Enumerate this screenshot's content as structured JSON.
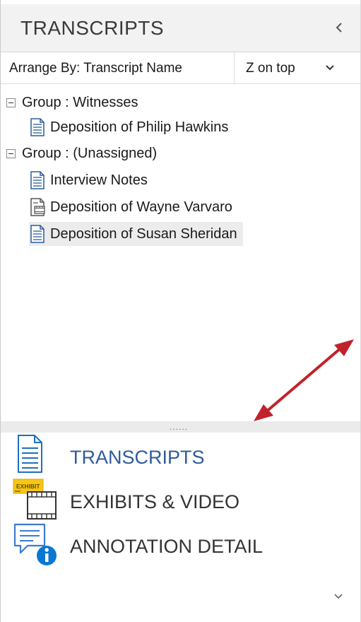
{
  "panel": {
    "title": "TRANSCRIPTS"
  },
  "arrange": {
    "label": "Arrange By: Transcript Name",
    "order_selected": "Z on top"
  },
  "tree": {
    "groups": [
      {
        "label": "Group : Witnesses",
        "items": [
          {
            "label": "Deposition of Philip Hawkins",
            "icon": "document-icon"
          }
        ]
      },
      {
        "label": "Group : (Unassigned)",
        "items": [
          {
            "label": "Interview Notes",
            "icon": "document-icon"
          },
          {
            "label": "Deposition of Wayne Varvaro",
            "icon": "video-document-icon"
          },
          {
            "label": "Deposition of Susan Sheridan",
            "icon": "document-icon",
            "selected": true
          }
        ]
      }
    ]
  },
  "splitter": {
    "grip": "......"
  },
  "nav": {
    "transcripts": "TRANSCRIPTS",
    "exhibits": "EXHIBITS & VIDEO",
    "exhibit_badge": "EXHIBIT",
    "annotation": "ANNOTATION DETAIL"
  },
  "colors": {
    "accent_blue": "#2f5b9c",
    "arrow_red": "#c0232b",
    "exhibit_yellow": "#f5c518",
    "info_blue": "#0a78d1"
  }
}
